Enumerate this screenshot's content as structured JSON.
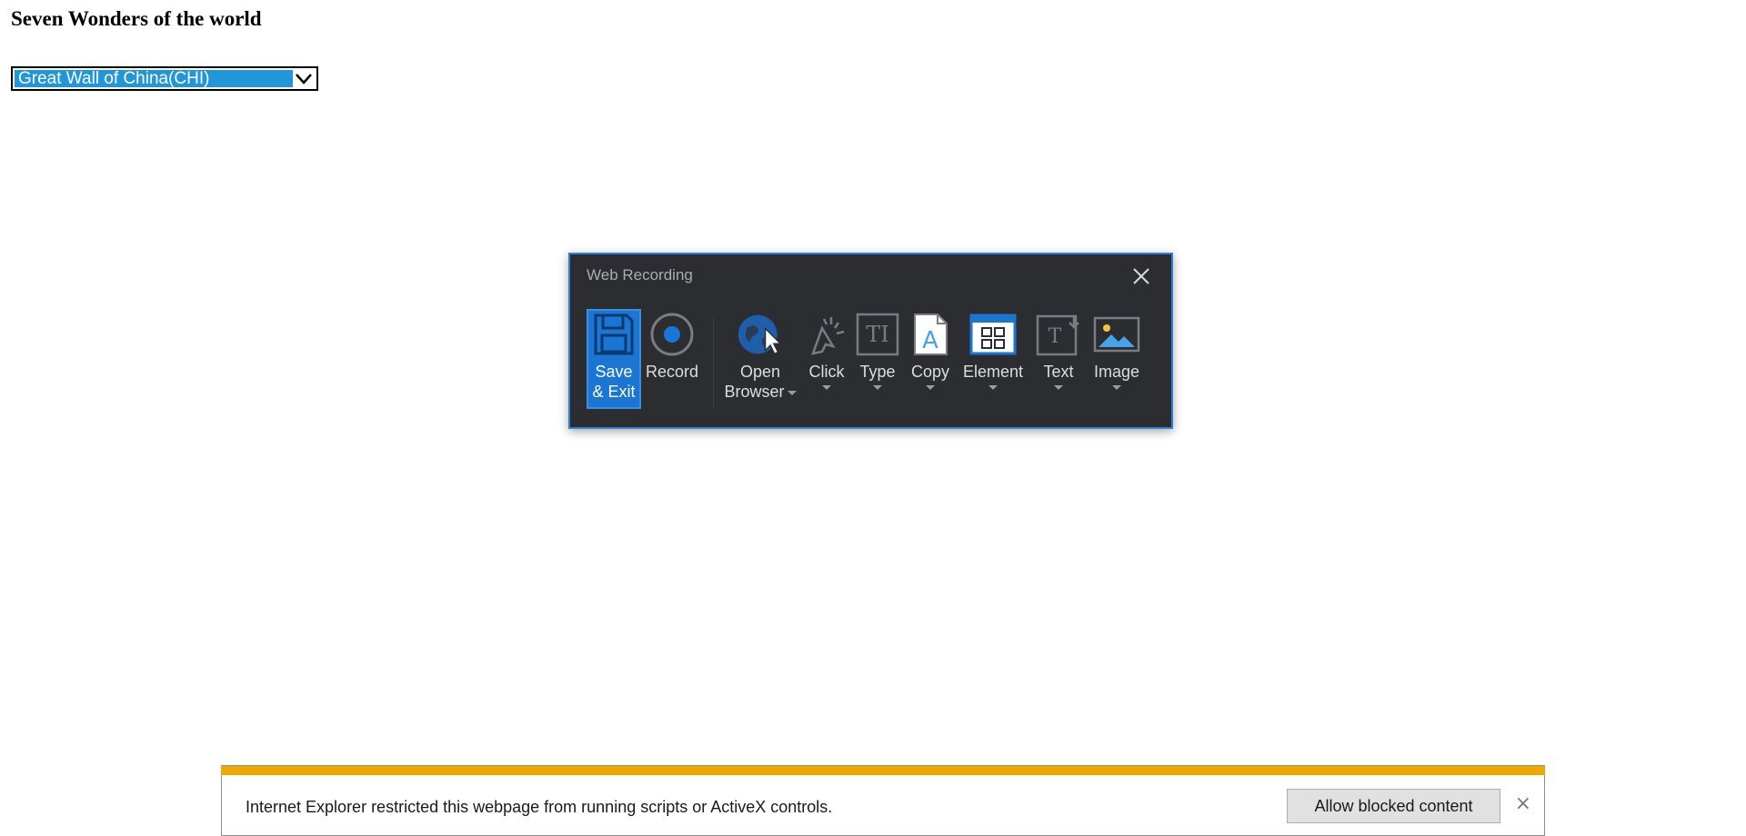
{
  "page": {
    "heading": "Seven Wonders of the world",
    "select": {
      "value": "Great Wall of China(CHI)"
    }
  },
  "recorder": {
    "title": "Web Recording",
    "tools": {
      "save_exit": "Save\n& Exit",
      "record": "Record",
      "open_browser": "Open\nBrowser",
      "click": "Click",
      "type": "Type",
      "copy": "Copy",
      "element": "Element",
      "text": "Text",
      "image": "Image"
    },
    "accent_color": "#1a76d2"
  },
  "notification": {
    "message": "Internet Explorer restricted this webpage from running scripts or ActiveX controls.",
    "button_label": "Allow blocked content",
    "close_glyph": "×",
    "stripe_color": "#f0a800"
  }
}
